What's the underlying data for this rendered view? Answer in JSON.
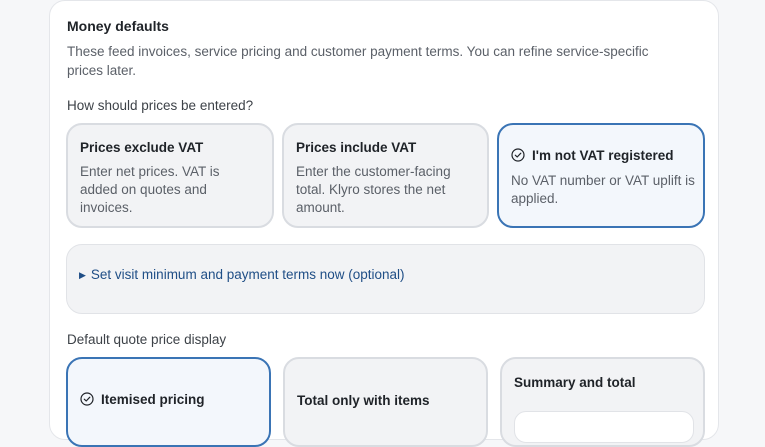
{
  "money_defaults": {
    "title": "Money defaults",
    "description": "These feed invoices, service pricing and customer payment terms. You can refine service-specific prices later."
  },
  "price_entry": {
    "question": "How should prices be entered?",
    "options": [
      {
        "title": "Prices exclude VAT",
        "description": "Enter net prices. VAT is added on quotes and invoices.",
        "selected": false
      },
      {
        "title": "Prices include VAT",
        "description": "Enter the customer-facing total. Klyro stores the net amount.",
        "selected": false
      },
      {
        "title": "I'm not VAT registered",
        "description": "No VAT number or VAT uplift is applied.",
        "selected": true,
        "icon": "check-circle-icon"
      }
    ]
  },
  "optional_terms": {
    "label": "Set visit minimum and payment terms now (optional)",
    "expanded": false,
    "icon": "triangle-right-icon"
  },
  "quote_display": {
    "label": "Default quote price display",
    "options": [
      {
        "title": "Itemised pricing",
        "selected": true,
        "icon": "check-circle-icon"
      },
      {
        "title": "Total only with items",
        "selected": false
      },
      {
        "title": "Summary and total",
        "selected": false
      }
    ]
  },
  "colors": {
    "accent": "#3a74b5",
    "link": "#1f4e86",
    "card_background": "#f2f3f5"
  }
}
